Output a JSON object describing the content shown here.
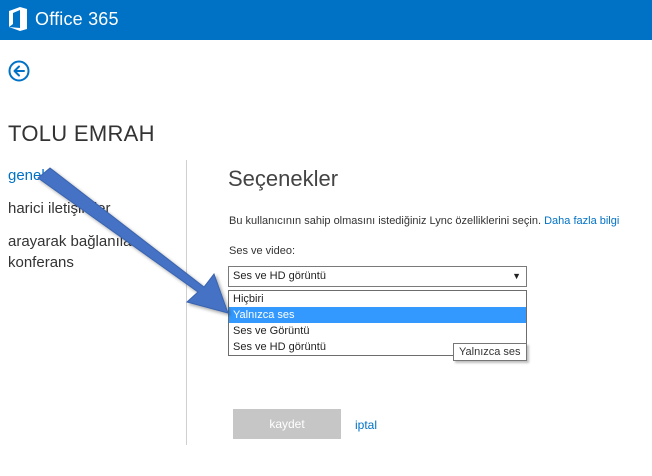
{
  "header": {
    "brand": "Office 365",
    "logo_icon": "office-logo-icon",
    "color": "#0072c6"
  },
  "back_icon": "back-arrow-icon",
  "user": {
    "name": "TOLU EMRAH"
  },
  "nav": {
    "items": [
      {
        "label": "genel"
      },
      {
        "label": "harici iletişimler"
      },
      {
        "label": "arayarak bağlanılan konferans"
      }
    ]
  },
  "options_section": {
    "title": "Seçenekler",
    "description": "Bu kullanıcının sahip olmasını istediğiniz Lync özelliklerini seçin.",
    "more_info_link": "Daha fazla bilgi",
    "field_label": "Ses ve video:",
    "select": {
      "value": "Ses ve HD görüntü",
      "options": [
        "Hiçbiri",
        "Yalnızca ses",
        "Ses ve Görüntü",
        "Ses ve HD görüntü"
      ],
      "highlighted": "Yalnızca ses"
    },
    "tooltip": "Yalnızca ses"
  },
  "actions": {
    "save_label": "kaydet",
    "cancel_label": "iptal"
  },
  "colors": {
    "accent": "#0072c6",
    "highlight": "#3399ff",
    "annotation_arrow": "#4472c4"
  }
}
